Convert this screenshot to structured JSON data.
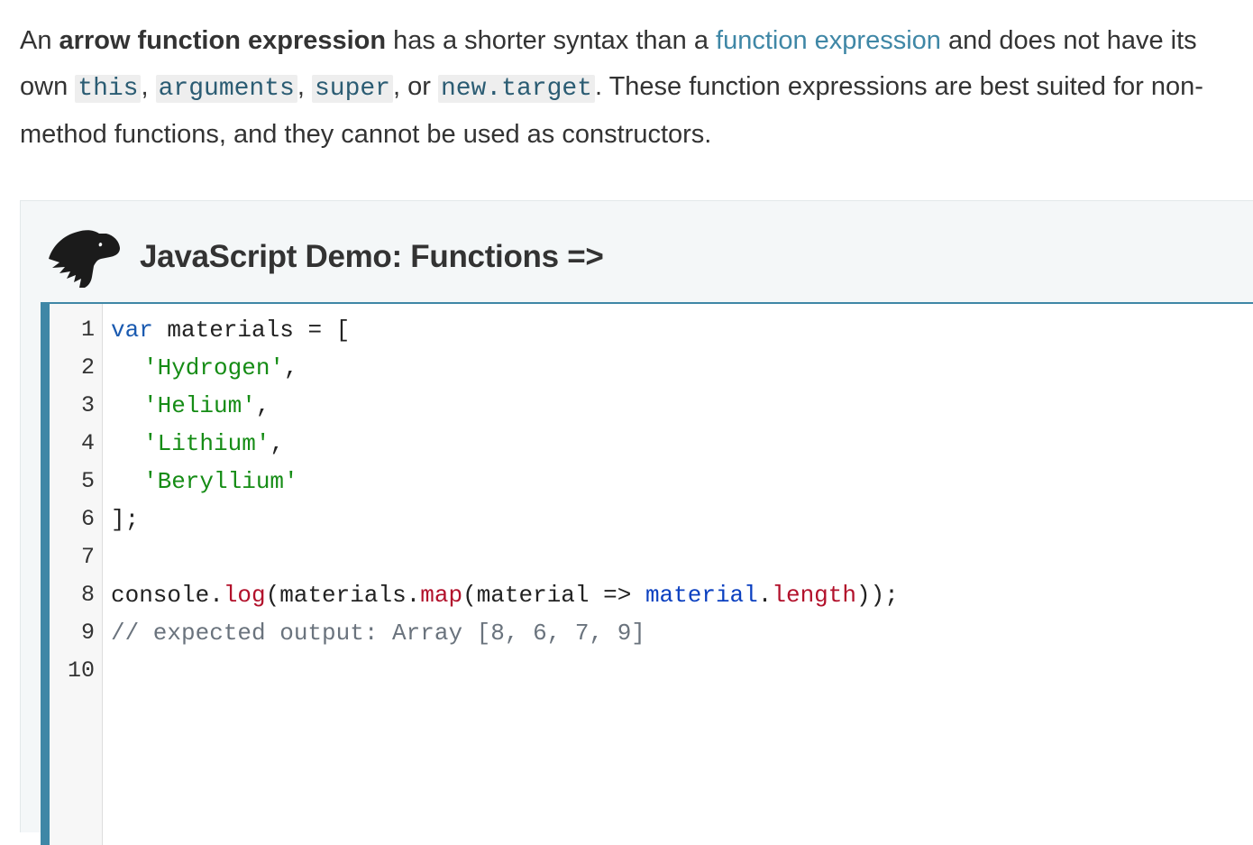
{
  "intro": {
    "t1": "An ",
    "bold": "arrow function expression",
    "t2": " has a shorter syntax than a ",
    "link": "function expression",
    "t3": " and does not have its own ",
    "code1": "this",
    "sep1": ", ",
    "code2": "arguments",
    "sep2": ", ",
    "code3": "super",
    "sep3": ", or ",
    "code4": "new.target",
    "t4": ". These function expressions are best suited for non-method functions, and they cannot be used as constructors."
  },
  "demo": {
    "title": "JavaScript Demo: Functions =>",
    "logo_icon": "dinosaur-head-icon",
    "line_numbers": [
      "1",
      "2",
      "3",
      "4",
      "5",
      "6",
      "7",
      "8",
      "9",
      "10"
    ],
    "code": {
      "l1_kw": "var",
      "l1_rest": " materials = [",
      "l2": "'Hydrogen'",
      "l2_tail": ",",
      "l3": "'Helium'",
      "l3_tail": ",",
      "l4": "'Lithium'",
      "l4_tail": ",",
      "l5": "'Beryllium'",
      "l6": "];",
      "l8_a": "console.",
      "l8_log": "log",
      "l8_b": "(materials.",
      "l8_map": "map",
      "l8_c": "(material => ",
      "l8_var": "material",
      "l8_d": ".",
      "l8_len": "length",
      "l8_e": "));",
      "l9": "// expected output: Array [8, 6, 7, 9]"
    }
  },
  "colors": {
    "accent": "#3f87a6",
    "keyword": "#1a5ab0",
    "string": "#158c15",
    "method": "#b2112b",
    "comment": "#6a737d"
  }
}
